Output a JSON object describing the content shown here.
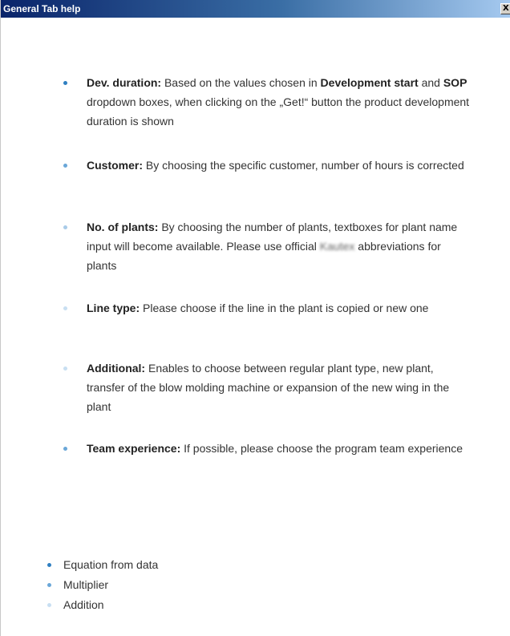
{
  "window": {
    "title": "General Tab help",
    "close_glyph": "X"
  },
  "help_items": [
    {
      "term": "Dev. duration:",
      "text_1": " Based on the values chosen in ",
      "bold_1": "Development start",
      "text_2": " and ",
      "bold_2": "SOP",
      "text_3": " dropdown boxes, when clicking on the „Get!“ button the product development duration is shown",
      "bullet_color": "#2f7fc1"
    },
    {
      "term": "Customer:",
      "text": " By choosing the specific customer, number of hours is corrected",
      "bullet_color": "#6aa7d8"
    },
    {
      "term": "No. of plants:",
      "text_1": " By choosing the number of plants, textboxes for plant name input will become available. Please use official ",
      "blurred": "Kautex",
      "text_2": " abbreviations for plants",
      "bullet_color": "#a9cbe8"
    },
    {
      "term": "Line type:",
      "text": "  Please choose if the line in the plant is copied or new one",
      "bullet_color": "#c8dff2"
    },
    {
      "term": "Additional:",
      "text": " Enables to choose between regular plant type, new plant, transfer of the blow molding machine or expansion of the new wing in the plant",
      "bullet_color": "#c8dff2"
    },
    {
      "term": "Team experience:",
      "text": " If possible, please choose the program team experience",
      "bullet_color": "#6aa7d8"
    }
  ],
  "legend": [
    {
      "label": "Equation from data",
      "color": "#2f7fc1"
    },
    {
      "label": "Multiplier",
      "color": "#6aa7d8"
    },
    {
      "label": "Addition",
      "color": "#c8dff2"
    }
  ]
}
